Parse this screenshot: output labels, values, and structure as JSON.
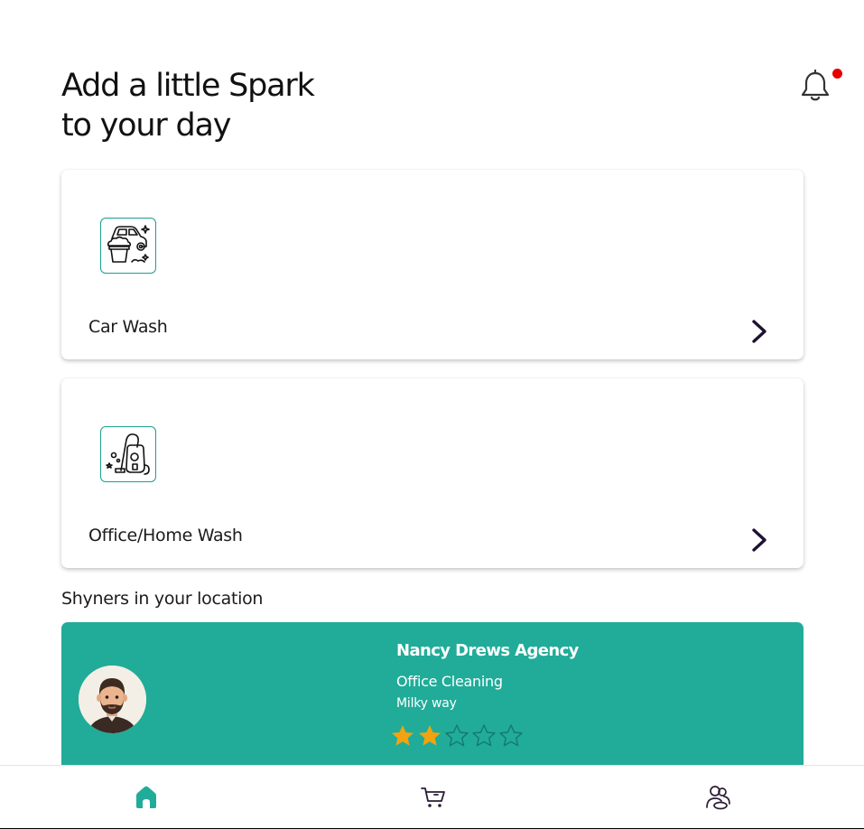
{
  "header": {
    "title_line1": "Add a little Spark",
    "title_line2": "to your day",
    "notification_dot_color": "#e60000"
  },
  "services": [
    {
      "label": "Car Wash",
      "icon": "car-wash-icon"
    },
    {
      "label": "Office/Home Wash",
      "icon": "vacuum-cleaner-icon"
    }
  ],
  "shyners": {
    "section_title": "Shyners in your location",
    "items": [
      {
        "name": "Nancy Drews Agency",
        "service": "Office Cleaning",
        "location": "Milky way",
        "rating": 2,
        "max_rating": 5
      }
    ]
  },
  "bottom_nav": {
    "items": [
      "home-icon",
      "cart-icon",
      "users-icon"
    ],
    "active": "home-icon"
  },
  "colors": {
    "accent": "#20ac99",
    "star_filled": "#f2a30f",
    "chevron": "#1e1233"
  }
}
